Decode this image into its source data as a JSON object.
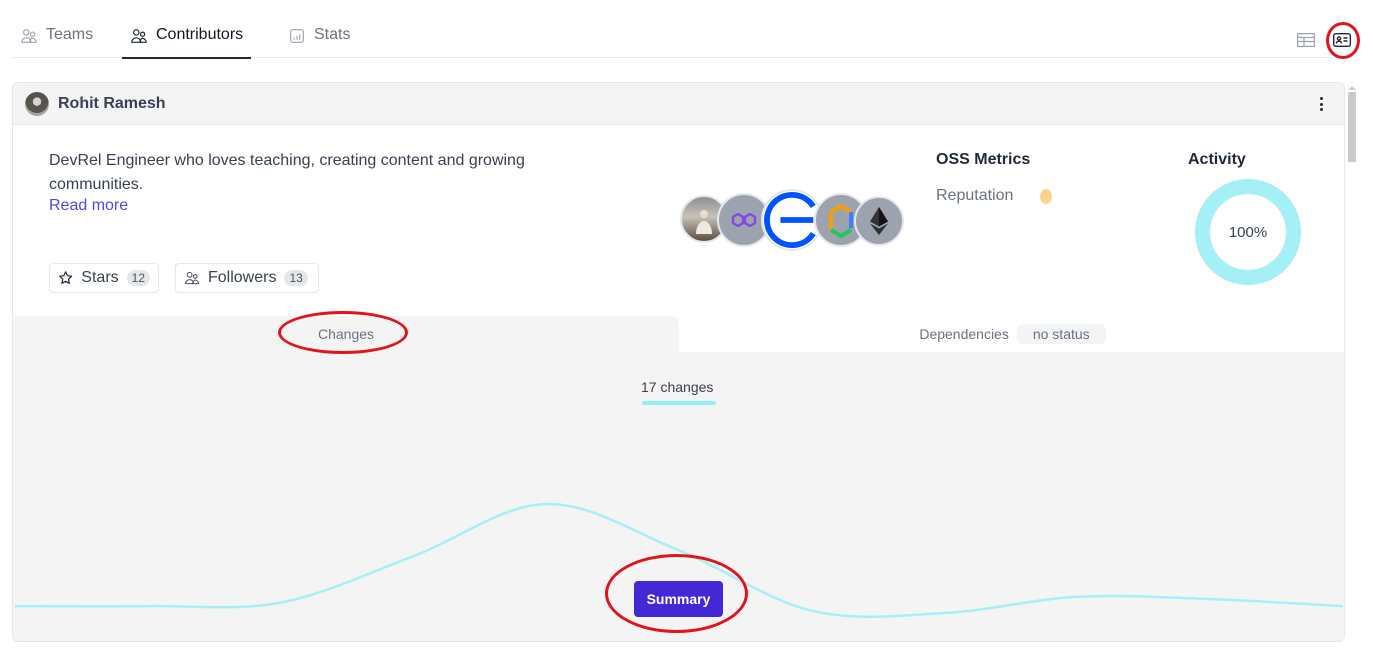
{
  "tabs": [
    {
      "label": "Teams",
      "icon": "users-icon",
      "active": false
    },
    {
      "label": "Contributors",
      "icon": "users-icon",
      "active": true
    },
    {
      "label": "Stats",
      "icon": "bar-chart-icon",
      "active": false
    }
  ],
  "view_toggle": {
    "options": [
      "table-view",
      "card-view"
    ],
    "selected": "card-view"
  },
  "contributor": {
    "name": "Rohit Ramesh",
    "bio": "DevRel Engineer who loves teaching, creating content and growing communities.",
    "read_more": "Read more",
    "stars": {
      "label": "Stars",
      "count": "12"
    },
    "followers": {
      "label": "Followers",
      "count": "13"
    },
    "organizations": [
      "user-photo",
      "polygon",
      "e-logo",
      "hexagon-logo",
      "ethereum"
    ],
    "oss_metrics": {
      "title": "OSS Metrics",
      "reputation_label": "Reputation",
      "reputation_color": "#fcd38d"
    },
    "activity": {
      "title": "Activity",
      "value": "100%",
      "color": "#a5f0f7"
    }
  },
  "subtabs": {
    "changes": "Changes",
    "dependencies": "Dependencies",
    "dependencies_status": "no status"
  },
  "changes_panel": {
    "count_label": "17 changes",
    "summary_button": "Summary",
    "line_color": "#a5f0f7",
    "trend": [
      0.12,
      0.12,
      0.15,
      0.55,
      1.0,
      0.6,
      0.08,
      0.06,
      0.2,
      0.18,
      0.12
    ]
  },
  "colors": {
    "accent": "#4329d6",
    "link": "#4f46e5",
    "annotation": "#e3131b"
  }
}
